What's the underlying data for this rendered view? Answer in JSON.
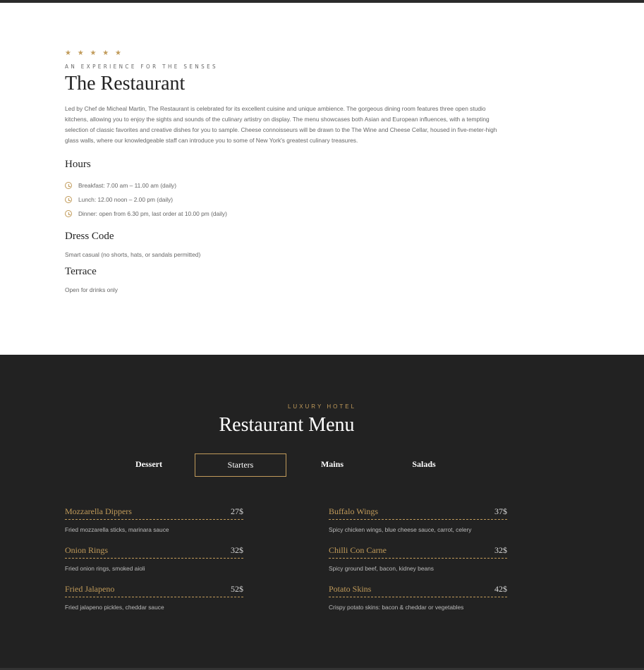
{
  "about": {
    "stars": "★ ★ ★ ★ ★",
    "rating": 5,
    "subtitle": "AN EXPERIENCE FOR THE SENSES",
    "title": "The Restaurant",
    "description": "Led by Chef de Micheal Martin, The Restaurant is celebrated for its excellent cuisine and unique ambience. The gorgeous dining room features three open studio kitchens, allowing you to enjoy the sights and sounds of the culinary artistry on display. The menu showcases both Asian and European influences, with a tempting selection of classic favorites and creative dishes for you to sample. Cheese connoisseurs will be drawn to the The Wine and Cheese Cellar, housed in five-meter-high glass walls, where our knowledgeable staff can introduce you to some of New York's greatest culinary treasures.",
    "hours_title": "Hours",
    "hours": [
      "Breakfast: 7.00 am – 11.00 am (daily)",
      "Lunch: 12.00 noon – 2.00 pm (daily)",
      "Dinner: open from 6.30 pm, last order at 10.00 pm (daily)"
    ],
    "dress_code_title": "Dress Code",
    "dress_code": "Smart casual (no shorts, hats, or sandals permitted)",
    "terrace_title": "Terrace",
    "terrace": "Open for drinks only"
  },
  "menu": {
    "subtitle": "LUXURY HOTEL",
    "title": "Restaurant Menu",
    "tabs": [
      "Dessert",
      "Starters",
      "Mains",
      "Salads"
    ],
    "active_tab": "Starters",
    "left_items": [
      {
        "name": "Mozzarella Dippers",
        "price": "27$",
        "desc": "Fried mozzarella sticks, marinara sauce"
      },
      {
        "name": "Onion Rings",
        "price": "32$",
        "desc": "Fried onion rings, smoked aioli"
      },
      {
        "name": "Fried Jalapeno",
        "price": "52$",
        "desc": "Fried jalapeno pickles, cheddar sauce"
      }
    ],
    "right_items": [
      {
        "name": "Buffalo Wings",
        "price": "37$",
        "desc": "Spicy chicken wings, blue cheese sauce, carrot, celery"
      },
      {
        "name": "Chilli Con Carne",
        "price": "32$",
        "desc": "Spicy ground beef, bacon, kidney beans"
      },
      {
        "name": "Potato Skins",
        "price": "42$",
        "desc": "Crispy potato skins: bacon & cheddar or vegetables"
      }
    ]
  },
  "colors": {
    "accent": "#c19b5a",
    "dark_bg": "#222222"
  }
}
